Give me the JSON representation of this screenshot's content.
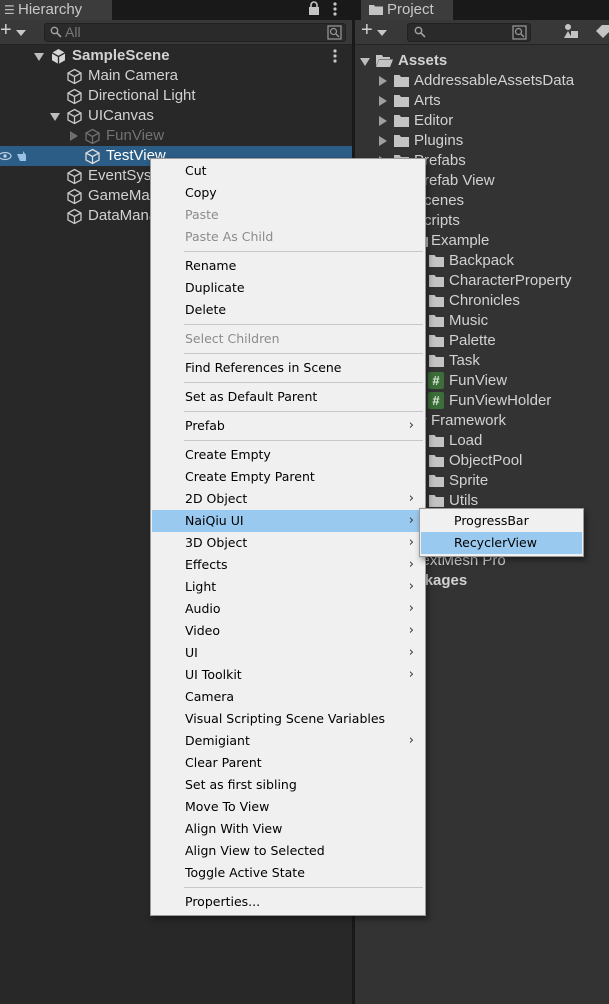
{
  "hierarchy": {
    "tab_label": "Hierarchy",
    "search_placeholder": "All",
    "add_label": "+",
    "scene_name": "SampleScene",
    "items": [
      {
        "label": "Main Camera"
      },
      {
        "label": "Directional Light"
      },
      {
        "label": "UICanvas"
      },
      {
        "label": "FunView"
      },
      {
        "label": "TestView"
      },
      {
        "label": "EventSystem"
      },
      {
        "label": "GameManager"
      },
      {
        "label": "DataManager"
      }
    ]
  },
  "project": {
    "tab_label": "Project",
    "add_label": "+",
    "assets_label": "Assets",
    "items": [
      {
        "label": "AddressableAssetsData"
      },
      {
        "label": "Arts"
      },
      {
        "label": "Editor"
      },
      {
        "label": "Plugins"
      },
      {
        "label": "Prefabs"
      },
      {
        "label": "Prefab View"
      },
      {
        "label": "Scenes"
      },
      {
        "label": "Scripts"
      },
      {
        "label": "Example"
      },
      {
        "label": "Backpack"
      },
      {
        "label": "CharacterProperty"
      },
      {
        "label": "Chronicles"
      },
      {
        "label": "Music"
      },
      {
        "label": "Palette"
      },
      {
        "label": "Task"
      },
      {
        "label": "FunView"
      },
      {
        "label": "FunViewHolder"
      },
      {
        "label": "Framework"
      },
      {
        "label": "Load"
      },
      {
        "label": "ObjectPool"
      },
      {
        "label": "Sprite"
      },
      {
        "label": "Utils"
      },
      {
        "label": "TextMesh Pro"
      },
      {
        "label": "Packages"
      }
    ]
  },
  "context_menu": {
    "items": [
      {
        "label": "Cut"
      },
      {
        "label": "Copy"
      },
      {
        "label": "Paste"
      },
      {
        "label": "Paste As Child"
      },
      {
        "label": "Rename"
      },
      {
        "label": "Duplicate"
      },
      {
        "label": "Delete"
      },
      {
        "label": "Select Children"
      },
      {
        "label": "Find References in Scene"
      },
      {
        "label": "Set as Default Parent"
      },
      {
        "label": "Prefab"
      },
      {
        "label": "Create Empty"
      },
      {
        "label": "Create Empty Parent"
      },
      {
        "label": "2D Object"
      },
      {
        "label": "NaiQiu UI"
      },
      {
        "label": "3D Object"
      },
      {
        "label": "Effects"
      },
      {
        "label": "Light"
      },
      {
        "label": "Audio"
      },
      {
        "label": "Video"
      },
      {
        "label": "UI"
      },
      {
        "label": "UI Toolkit"
      },
      {
        "label": "Camera"
      },
      {
        "label": "Visual Scripting Scene Variables"
      },
      {
        "label": "Demigiant"
      },
      {
        "label": "Clear Parent"
      },
      {
        "label": "Set as first sibling"
      },
      {
        "label": "Move To View"
      },
      {
        "label": "Align With View"
      },
      {
        "label": "Align View to Selected"
      },
      {
        "label": "Toggle Active State"
      },
      {
        "label": "Properties..."
      }
    ],
    "submenu_arrow": "›"
  },
  "submenu": {
    "items": [
      {
        "label": "ProgressBar"
      },
      {
        "label": "RecyclerView"
      }
    ]
  }
}
